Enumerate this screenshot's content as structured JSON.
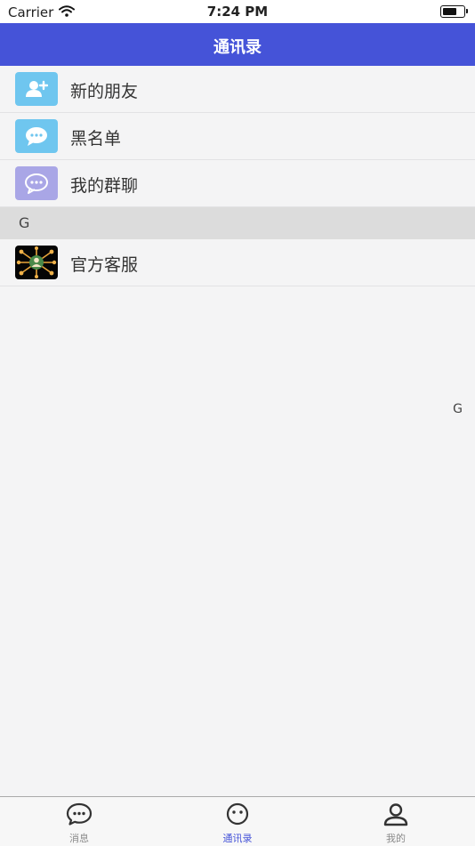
{
  "status_bar": {
    "carrier": "Carrier",
    "time": "7:24 PM"
  },
  "nav": {
    "title": "通讯录"
  },
  "menu": [
    {
      "label": "新的朋友",
      "icon": "add-friend-icon",
      "color": "#6fc6ef"
    },
    {
      "label": "黑名单",
      "icon": "chat-bubble-icon",
      "color": "#6fc6ef"
    },
    {
      "label": "我的群聊",
      "icon": "group-chat-icon",
      "color": "#a9a6e6"
    }
  ],
  "sections": [
    {
      "letter": "G",
      "contacts": [
        {
          "name": "官方客服",
          "avatar": "network-avatar-icon"
        }
      ]
    }
  ],
  "index_bar": {
    "letters": [
      "G"
    ]
  },
  "tabs": [
    {
      "label": "消息",
      "icon": "message-icon",
      "active": false
    },
    {
      "label": "通讯录",
      "icon": "contacts-icon",
      "active": true
    },
    {
      "label": "我的",
      "icon": "profile-icon",
      "active": false
    }
  ],
  "colors": {
    "accent": "#4553d8",
    "background": "#f4f4f5",
    "section_bg": "#dcdcdc"
  }
}
